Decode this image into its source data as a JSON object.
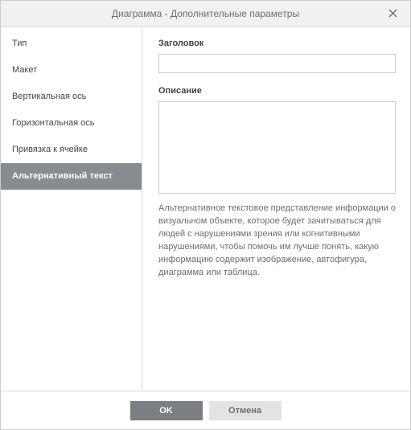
{
  "title": "Диаграмма - Дополнительные параметры",
  "sidebar": {
    "items": [
      {
        "label": "Тип"
      },
      {
        "label": "Макет"
      },
      {
        "label": "Вертикальная ось"
      },
      {
        "label": "Горизонтальная ось"
      },
      {
        "label": "Привязка к ячейке"
      },
      {
        "label": "Альтернативный текст"
      }
    ]
  },
  "content": {
    "title_label": "Заголовок",
    "title_value": "",
    "description_label": "Описание",
    "description_value": "",
    "help_text": "Альтернативное текстовое представление информации о визуальном объекте, которое будет зачитываться для людей с нарушениями зрения или когнитивными нарушениями, чтобы помочь им лучше понять, какую информацию содержит изображение, автофигура, диаграмма или таблица."
  },
  "footer": {
    "ok_label": "OK",
    "cancel_label": "Отмена"
  }
}
